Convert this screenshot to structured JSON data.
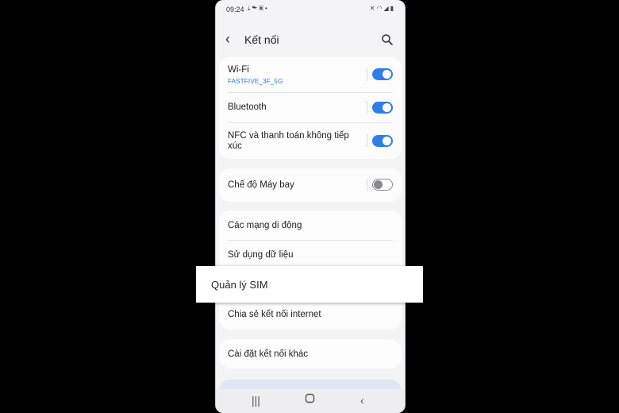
{
  "status_bar": {
    "time": "09:24",
    "left_icons": [
      "download-icon",
      "cloud-icon",
      "image-icon",
      "dot-icon"
    ],
    "right_icons": [
      "mute-icon",
      "wifi-icon",
      "signal-icon",
      "battery-icon"
    ]
  },
  "header": {
    "title": "Kết nối"
  },
  "settings": {
    "wifi": {
      "label": "Wi-Fi",
      "network": "FASTFIVE_3F_5G",
      "enabled": true
    },
    "bluetooth": {
      "label": "Bluetooth",
      "enabled": true
    },
    "nfc": {
      "label_line1": "NFC và thanh toán không tiếp",
      "label_line2": "xúc",
      "enabled": true
    },
    "airplane": {
      "label": "Chế độ Máy bay",
      "enabled": false
    },
    "mobile_networks": {
      "label": "Các mạng di động"
    },
    "data_usage": {
      "label": "Sử dụng dữ liệu"
    },
    "sim_manager": {
      "label": "Quản lý SIM"
    },
    "hotspot": {
      "label": "Chia sẻ kết nối internet"
    },
    "more_settings": {
      "label": "Cài đặt kết nối khác"
    }
  },
  "colors": {
    "toggle_on": "#2f7ee5",
    "network_text": "#2a7bd8",
    "background": "#f4f4f6"
  }
}
